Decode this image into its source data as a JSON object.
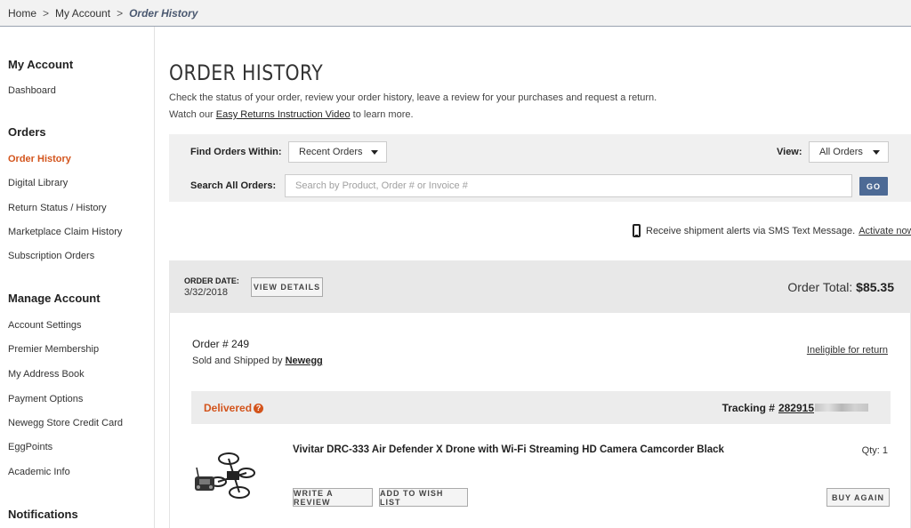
{
  "breadcrumb": {
    "home": "Home",
    "sep": ">",
    "account": "My Account",
    "current": "Order History"
  },
  "sidebar": {
    "my_account": {
      "heading": "My Account",
      "items": [
        "Dashboard"
      ]
    },
    "orders": {
      "heading": "Orders",
      "items": [
        "Order History",
        "Digital Library",
        "Return Status / History",
        "Marketplace Claim History",
        "Subscription Orders"
      ]
    },
    "manage": {
      "heading": "Manage Account",
      "items": [
        "Account Settings",
        "Premier Membership",
        "My Address Book",
        "Payment Options",
        "Newegg Store Credit Card",
        "EggPoints",
        "Academic Info"
      ]
    },
    "notifications": {
      "heading": "Notifications"
    }
  },
  "page": {
    "title": "ORDER HISTORY",
    "intro_line1": "Check the status of your order, review your order history, leave a review for your purchases and request a return.",
    "intro_prefix": "Watch our ",
    "intro_link": "Easy Returns Instruction Video",
    "intro_suffix": " to learn more."
  },
  "filter": {
    "find_label": "Find Orders Within:",
    "find_value": "Recent Orders",
    "view_label": "View:",
    "view_value": "All Orders",
    "search_label": "Search All Orders:",
    "search_placeholder": "Search by Product, Order # or Invoice #",
    "go_label": "GO"
  },
  "sms": {
    "text": "Receive shipment alerts via SMS Text Message.",
    "link": "Activate now"
  },
  "order": {
    "date_label": "ORDER DATE:",
    "date": "3/32/2018",
    "view_details": "VIEW DETAILS",
    "total_label": "Order Total:",
    "total": "$85.35",
    "number": "Order # 249",
    "sold_prefix": "Sold and Shipped by ",
    "seller": "Newegg",
    "return_status": "Ineligible for return",
    "status": "Delivered",
    "tracking_label": "Tracking #",
    "tracking_number": "282915",
    "product_name": "Vivitar DRC-333 Air Defender X Drone with Wi-Fi Streaming HD Camera Camcorder Black",
    "qty": "Qty: 1",
    "write_review": "WRITE A REVIEW",
    "add_wish": "ADD TO WISH LIST",
    "buy_again": "BUY AGAIN"
  },
  "colors": {
    "accent": "#d3541c",
    "go_button": "#4d6a95",
    "filter_bg": "#f0f0f0",
    "order_head_bg": "#e8e8e8"
  },
  "icons": {
    "phone": "phone-icon",
    "help": "question-circle-icon",
    "caret": "caret-down-icon",
    "product": "drone-image"
  }
}
